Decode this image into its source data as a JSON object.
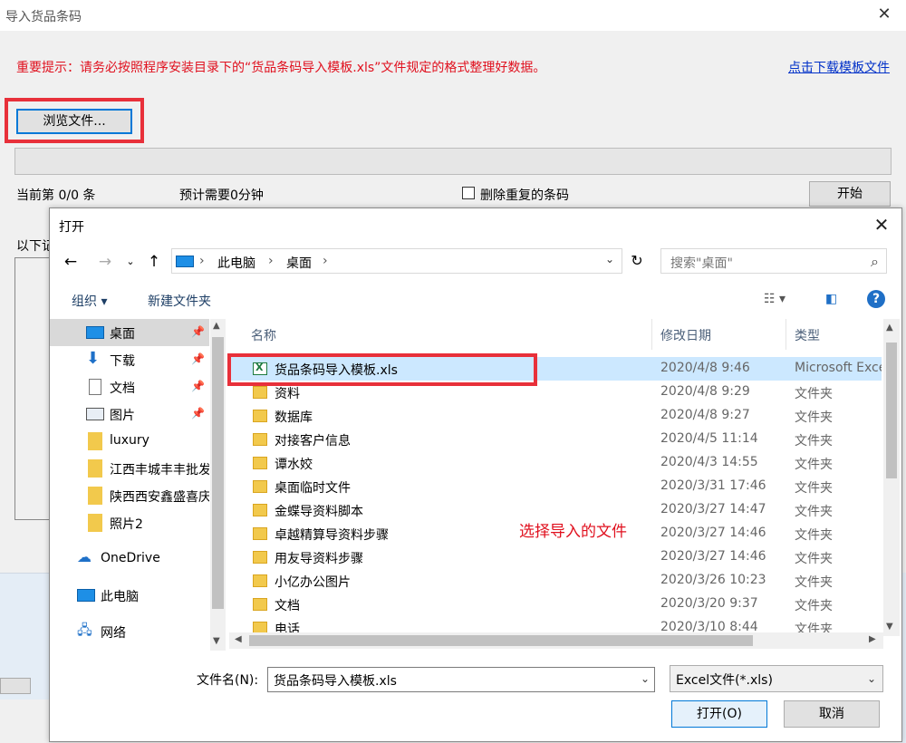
{
  "parent_window": {
    "title": "导入货品条码",
    "notice": "重要提示：请务必按照程序安装目录下的“货品条码导入模板.xls”文件规定的格式整理好数据。",
    "download_link": "点击下载模板文件",
    "browse_button": "浏览文件...",
    "status_current": "当前第 0/0 条",
    "status_estimate": "预计需要0分钟",
    "delete_duplicates_label": "删除重复的条码",
    "delete_duplicates_checked": false,
    "start_button": "开始",
    "below_label": "以下记"
  },
  "open_dialog": {
    "title": "打开",
    "address": {
      "segments": [
        "此电脑",
        "桌面"
      ],
      "separator": "›"
    },
    "search_placeholder": "搜索\"桌面\"",
    "toolbar": {
      "organize": "组织 ▾",
      "new_folder": "新建文件夹",
      "help": "?"
    },
    "nav_items": [
      {
        "label": "桌面",
        "icon": "desktop-icon",
        "pinned": true,
        "selected": true
      },
      {
        "label": "下载",
        "icon": "download-icon",
        "pinned": true
      },
      {
        "label": "文档",
        "icon": "document-icon",
        "pinned": true
      },
      {
        "label": "图片",
        "icon": "picture-icon",
        "pinned": true
      },
      {
        "label": "luxury",
        "icon": "folder-icon"
      },
      {
        "label": "江西丰城丰丰批发",
        "icon": "folder-icon"
      },
      {
        "label": "陕西西安鑫盛喜庆",
        "icon": "folder-icon"
      },
      {
        "label": "照片2",
        "icon": "folder-icon"
      },
      {
        "label": "OneDrive",
        "icon": "cloud-icon"
      },
      {
        "label": "此电脑",
        "icon": "computer-icon"
      },
      {
        "label": "网络",
        "icon": "network-icon"
      }
    ],
    "columns": [
      "名称",
      "修改日期",
      "类型"
    ],
    "files": [
      {
        "name": "货品条码导入模板.xls",
        "date": "2020/4/8 9:46",
        "type": "Microsoft Excel",
        "kind": "xls",
        "selected": true
      },
      {
        "name": "资料",
        "date": "2020/4/8 9:29",
        "type": "文件夹",
        "kind": "folder"
      },
      {
        "name": "数据库",
        "date": "2020/4/8 9:27",
        "type": "文件夹",
        "kind": "folder"
      },
      {
        "name": "对接客户信息",
        "date": "2020/4/5 11:14",
        "type": "文件夹",
        "kind": "folder"
      },
      {
        "name": "谭水姣",
        "date": "2020/4/3 14:55",
        "type": "文件夹",
        "kind": "folder"
      },
      {
        "name": "桌面临时文件",
        "date": "2020/3/31 17:46",
        "type": "文件夹",
        "kind": "folder"
      },
      {
        "name": "金蝶导资料脚本",
        "date": "2020/3/27 14:47",
        "type": "文件夹",
        "kind": "folder"
      },
      {
        "name": "卓越精算导资料步骤",
        "date": "2020/3/27 14:46",
        "type": "文件夹",
        "kind": "folder"
      },
      {
        "name": "用友导资料步骤",
        "date": "2020/3/27 14:46",
        "type": "文件夹",
        "kind": "folder"
      },
      {
        "name": "小亿办公图片",
        "date": "2020/3/26 10:23",
        "type": "文件夹",
        "kind": "folder"
      },
      {
        "name": "文档",
        "date": "2020/3/20 9:37",
        "type": "文件夹",
        "kind": "folder"
      },
      {
        "name": "电话",
        "date": "2020/3/10 8:44",
        "type": "文件夹",
        "kind": "folder"
      }
    ],
    "annotation": "选择导入的文件",
    "filename_label": "文件名(N):",
    "filename_value": "货品条码导入模板.xls",
    "filetype_value": "Excel文件(*.xls)",
    "open_button": "打开(O)",
    "cancel_button": "取消"
  },
  "colors": {
    "notice_red": "#e0101e",
    "highlight_frame": "#e8303a",
    "link_blue": "#0030c8",
    "selected_row": "#cce8ff",
    "accent": "#0078d7"
  }
}
